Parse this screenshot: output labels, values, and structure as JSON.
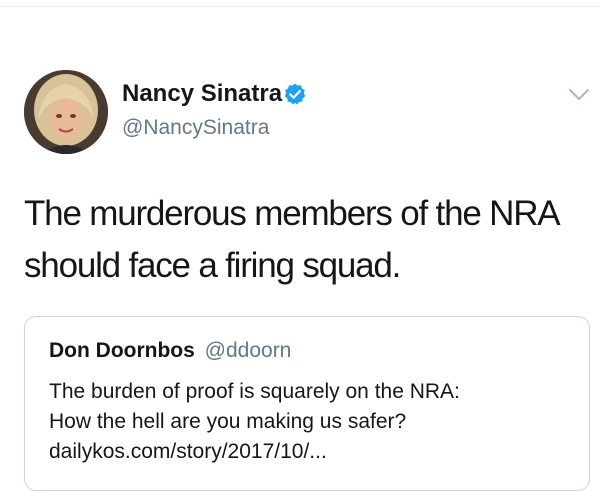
{
  "tweet": {
    "author_name": "Nancy Sinatra",
    "author_handle": "@NancySinatra",
    "verified": true,
    "text": "The murderous members of the NRA should face a firing squad.",
    "icons": {
      "verified": "verified-badge-icon",
      "menu": "chevron-down-icon"
    }
  },
  "quoted_tweet": {
    "author_name": "Don Doornbos",
    "author_handle": "@ddoorn",
    "line1": "The burden of proof is squarely on the NRA:",
    "line2": "How the hell are you making us safer?",
    "line3": "dailykos.com/story/2017/10/..."
  },
  "colors": {
    "text_primary": "#14171a",
    "text_secondary": "#657786",
    "verified_blue": "#1da1f2",
    "border": "#ccd6dd",
    "chevron": "#aab8c2"
  }
}
